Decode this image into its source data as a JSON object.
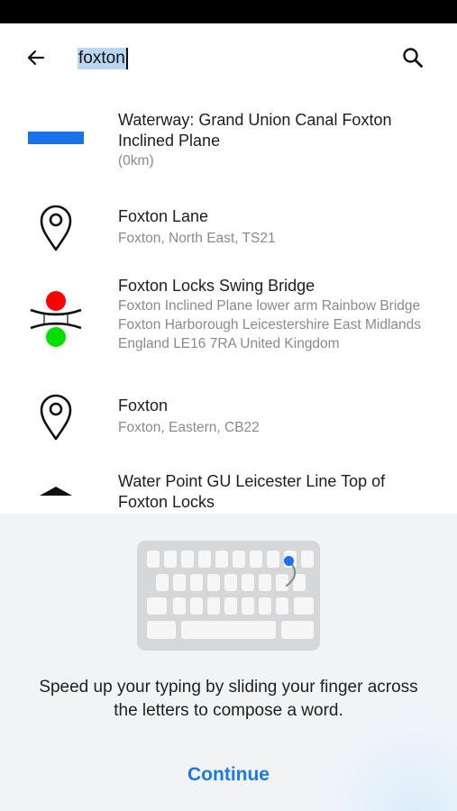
{
  "search": {
    "query": "foxton",
    "back_icon": "arrow-left-icon",
    "search_icon": "search-icon"
  },
  "results": [
    {
      "icon": "waterway-line-icon",
      "title": "Waterway: Grand Union Canal Foxton Inclined Plane",
      "subtitle": "(0km)"
    },
    {
      "icon": "map-pin-icon",
      "title": "Foxton Lane",
      "subtitle": "Foxton, North East, TS21"
    },
    {
      "icon": "swing-bridge-icon",
      "title": "Foxton Locks Swing Bridge",
      "subtitle": "Foxton Inclined Plane lower arm  Rainbow Bridge  Foxton  Harborough  Leicestershire  East Midlands  England  LE16 7RA  United Kingdom"
    },
    {
      "icon": "map-pin-icon",
      "title": "Foxton",
      "subtitle": "Foxton, Eastern, CB22"
    },
    {
      "icon": "water-point-icon",
      "title": "Water Point GU Leicester Line Top of Foxton Locks",
      "subtitle": ""
    }
  ],
  "onboarding": {
    "illustration_icon": "swipe-keyboard-icon",
    "message": "Speed up your typing by sliding your finger across the letters to compose a word.",
    "continue_label": "Continue"
  },
  "colors": {
    "accent": "#1a7ae0",
    "waterway": "#1a73e8",
    "signal_red": "#ff0000",
    "signal_green": "#00e000",
    "selection": "#b9d7f5"
  }
}
